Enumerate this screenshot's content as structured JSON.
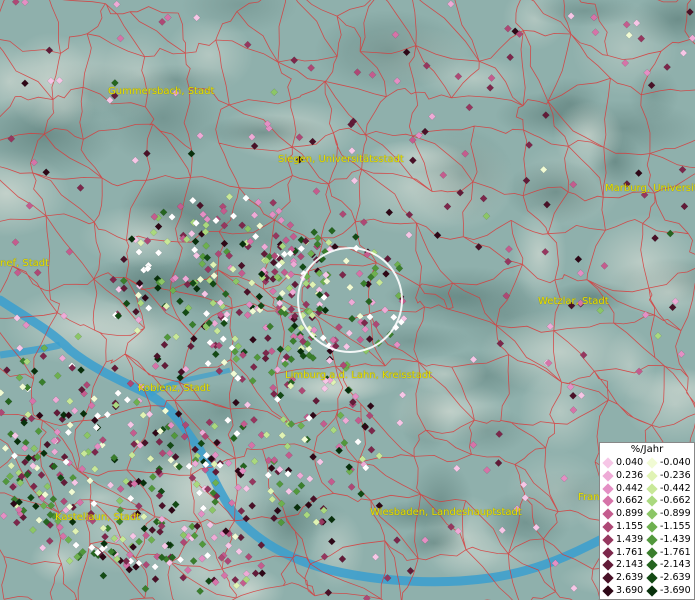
{
  "places": [
    {
      "name": "Gummersbach, Stadt"
    },
    {
      "name": "Siegen, Universitätsstadt"
    },
    {
      "name": "Marburg, Universit"
    },
    {
      "name": "Wetzlar, Stadt"
    },
    {
      "name": "Limburg a.d. Lahn, Kreisstadt"
    },
    {
      "name": "Koblenz, Stadt"
    },
    {
      "name": "Kastellaun, Stadt"
    },
    {
      "name": "Wiesbaden, Landeshauptstadt"
    },
    {
      "name": "nef, Stadt"
    },
    {
      "name": "Fran"
    }
  ],
  "legend": {
    "title": "%/Jahr",
    "positive": [
      {
        "label": "0.040",
        "color": "#f6c6e6"
      },
      {
        "label": "0.236",
        "color": "#eeaad6"
      },
      {
        "label": "0.442",
        "color": "#e48fc4"
      },
      {
        "label": "0.662",
        "color": "#d673a8"
      },
      {
        "label": "0.899",
        "color": "#c45c8e"
      },
      {
        "label": "1.155",
        "color": "#ae4875"
      },
      {
        "label": "1.439",
        "color": "#96375f"
      },
      {
        "label": "1.761",
        "color": "#7c274b"
      },
      {
        "label": "2.143",
        "color": "#621b38"
      },
      {
        "label": "2.639",
        "color": "#491127"
      },
      {
        "label": "3.690",
        "color": "#2e0716"
      }
    ],
    "negative": [
      {
        "label": "-0.040",
        "color": "#f1fbd4"
      },
      {
        "label": "-0.236",
        "color": "#e0f3b4"
      },
      {
        "label": "-0.442",
        "color": "#c8e898"
      },
      {
        "label": "-0.662",
        "color": "#aad97e"
      },
      {
        "label": "-0.899",
        "color": "#8cc666"
      },
      {
        "label": "-1.155",
        "color": "#6eb04f"
      },
      {
        "label": "-1.439",
        "color": "#52983c"
      },
      {
        "label": "-1.761",
        "color": "#3a7e2c"
      },
      {
        "label": "-2.143",
        "color": "#25641f"
      },
      {
        "label": "-2.639",
        "color": "#134a14"
      },
      {
        "label": "-3.690",
        "color": "#08300b"
      }
    ]
  },
  "colors": {
    "terrain": "#8fb0ac",
    "river": "#3a9fcf",
    "border": "#d83a3a",
    "label": "#e8e000",
    "highlight_circle": "#ffffff"
  }
}
